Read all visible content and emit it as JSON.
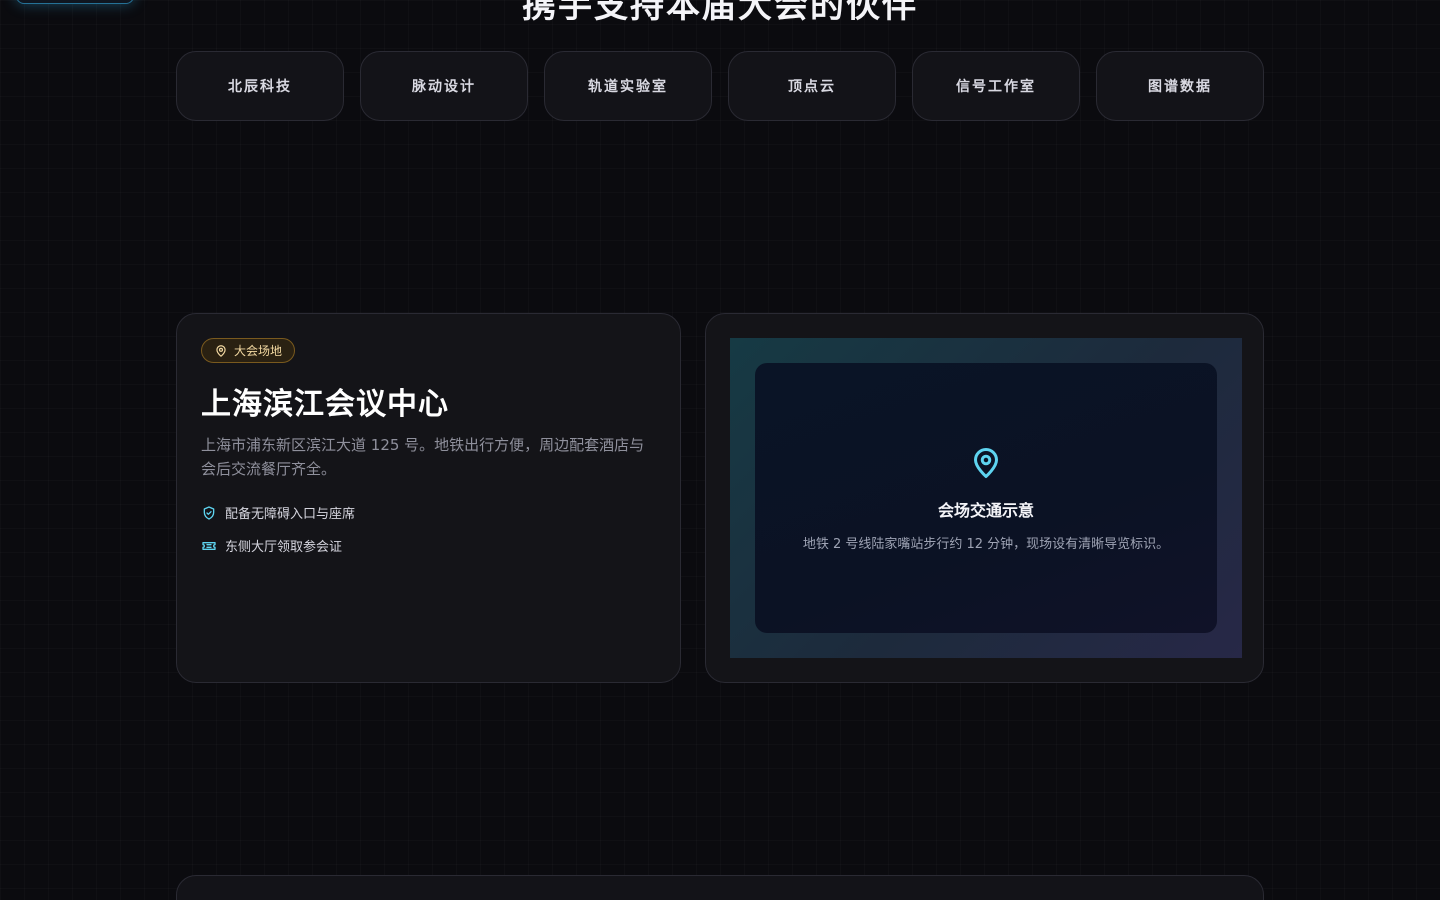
{
  "header": {
    "title": "携手支持本届大会的伙伴"
  },
  "sponsors": [
    {
      "name": "北辰科技"
    },
    {
      "name": "脉动设计"
    },
    {
      "name": "轨道实验室"
    },
    {
      "name": "顶点云"
    },
    {
      "name": "信号工作室"
    },
    {
      "name": "图谱数据"
    }
  ],
  "venue": {
    "badge": "大会场地",
    "badge_icon": "map-pin-icon",
    "title": "上海滨江会议中心",
    "description": "上海市浦东新区滨江大道 125 号。地铁出行方便，周边配套酒店与会后交流餐厅齐全。",
    "features": [
      {
        "icon": "shield-check-icon",
        "label": "配备无障碍入口与座席"
      },
      {
        "icon": "ticket-icon",
        "label": "东侧大厅领取参会证"
      }
    ]
  },
  "map": {
    "icon": "map-pin-icon",
    "title": "会场交通示意",
    "description": "地铁 2 号线陆家嘴站步行约 12 分钟，现场设有清晰导览标识。"
  },
  "colors": {
    "accent_cyan": "#5ed4f0",
    "badge_gold": "#f3d9a2",
    "background": "#0b0b0f"
  }
}
